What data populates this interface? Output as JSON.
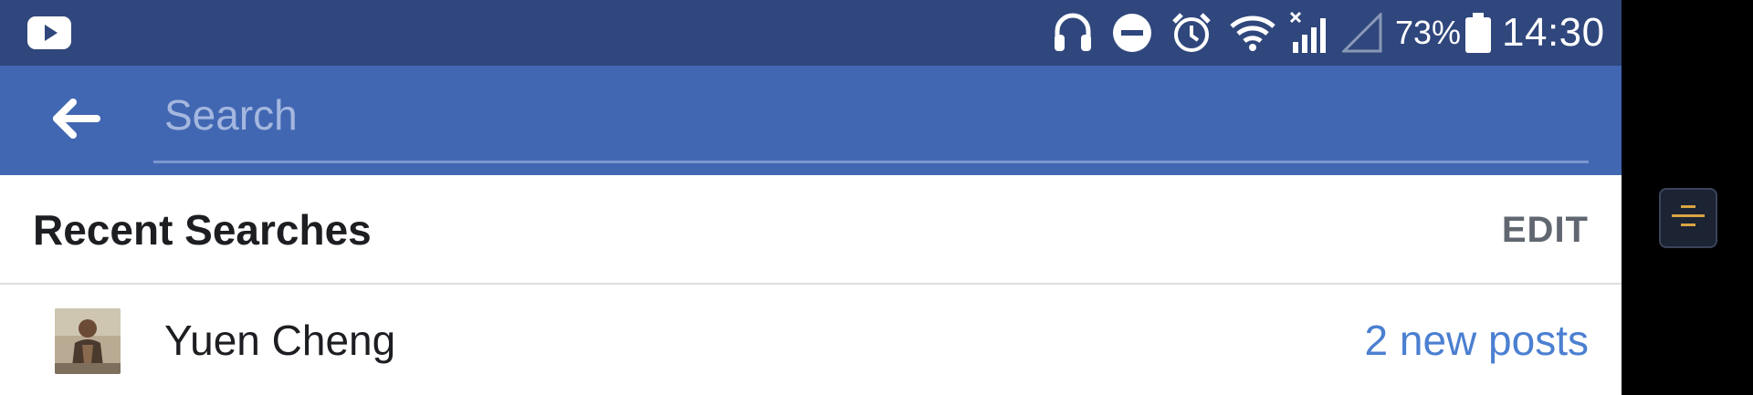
{
  "status_bar": {
    "battery_percent": "73%",
    "time": "14:30",
    "icons": [
      "youtube-icon",
      "headphones-icon",
      "do-not-disturb-icon",
      "alarm-icon",
      "wifi-icon",
      "signal-icon",
      "signal-empty-icon",
      "battery-icon"
    ]
  },
  "search": {
    "placeholder": "Search",
    "value": ""
  },
  "recent": {
    "title": "Recent Searches",
    "edit_label": "EDIT"
  },
  "results": [
    {
      "name": "Yuen Cheng",
      "badge": "2 new posts"
    }
  ],
  "colors": {
    "status_bar": "#30477d",
    "brand_blue": "#4267b2",
    "link_blue": "#4b7fd1",
    "float_accent": "#d9a441"
  }
}
